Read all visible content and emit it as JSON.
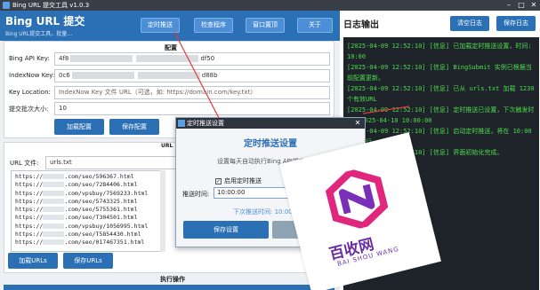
{
  "window": {
    "title": "Bing URL 提交工具 v1.0.3",
    "minimize": "–",
    "maximize": "□",
    "close": "✕"
  },
  "header": {
    "title": "Bing URL 提交",
    "subtitle": "Bing URL提交工具，批量…",
    "buttons": [
      "定时推送",
      "检查程序",
      "窗口置顶",
      "关于"
    ]
  },
  "config": {
    "title": "配置",
    "api_key_label": "Bing API Key:",
    "api_key_prefix": "4f8",
    "api_key_suffix": "df50",
    "indexnow_label": "IndexNow Key:",
    "indexnow_prefix": "0c6",
    "indexnow_suffix": "d88b",
    "key_location_label": "Key Location:",
    "key_location_placeholder": "IndexNow Key 文件 URL（可选，如: https://domain.com/key.txt）",
    "batch_label": "提交批次大小:",
    "batch_value": "10",
    "load_button": "加载配置",
    "save_button": "保存配置"
  },
  "urls": {
    "title": "URL",
    "file_label": "URL 文件:",
    "file_value": "urls.txt",
    "items": [
      {
        "prefix": "https://",
        "suffix": ".com/seo/596367.html"
      },
      {
        "prefix": "https://",
        "suffix": ".com/seo/7284406.html"
      },
      {
        "prefix": "https://",
        "suffix": ".com/vpsbuy/7569233.html"
      },
      {
        "prefix": "https://",
        "suffix": ".com/seo/5743325.html"
      },
      {
        "prefix": "https://",
        "suffix": ".com/seo/5755361.html"
      },
      {
        "prefix": "https://",
        "suffix": ".com/seo/T304501.html"
      },
      {
        "prefix": "https://",
        "suffix": ".com/vpsbuy/1056995.html"
      },
      {
        "prefix": "https://",
        "suffix": ".com/seo/T5854430.html"
      },
      {
        "prefix": "https://",
        "suffix": ".com/seo/017467351.html"
      }
    ],
    "load_button": "加载URLs",
    "save_button": "保存URLs"
  },
  "exec": {
    "title": "执行操作"
  },
  "log": {
    "title": "日志输出",
    "clear_button": "清空日志",
    "save_button": "保存日志",
    "lines": [
      "[2025-04-09 12:52:10] [信息] 已加载定时推送设置，时间: 10:00",
      "[2025-04-09 12:52:10] [信息] BingSubmit 实例已根据当前配置更新。",
      "[2025-04-09 12:52:10] [信息] 已从 urls.txt 加载 1230 个有效URL",
      "[2025-04-09 12:52:10] [信息] 定时推送已设置，下次触发时间: 2025-04-10 10:00:00",
      "[2025-04-09 12:52:10] [信息] 启动定时推送，将在 10:00 自动执行",
      "[2025-04-09 12:52:10] [信息] 界面初始化完成。"
    ]
  },
  "dialog": {
    "title": "定时推送设置",
    "heading": "定时推送设置",
    "description": "设置每天自动执行Bing API提交的时间",
    "checkbox_label": "启用定时推送",
    "checkbox_mark": "✓",
    "time_label": "推送时间:",
    "time_value": "10:00:00",
    "next_run": "下次推送时间: 10:00:00",
    "save_button": "保存设置",
    "close": "✕"
  },
  "logo": {
    "name": "百收网",
    "pinyin": "BAI SHOU WANG"
  },
  "colors": {
    "primary": "#2b6fb5",
    "log_bg": "#1e2429",
    "log_text": "#4ddc4d",
    "logo": "#6b2fa3"
  }
}
